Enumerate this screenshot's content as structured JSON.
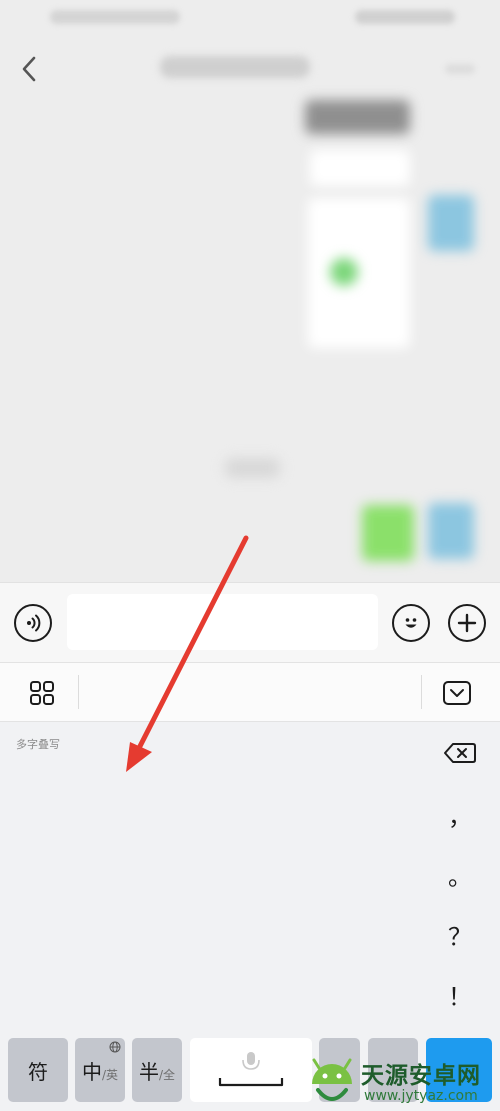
{
  "chat": {
    "title": "",
    "status_left": "",
    "status_right": ""
  },
  "input_bar": {
    "placeholder": ""
  },
  "keyboard": {
    "handwriting_hint": "多字叠写",
    "punctuation": {
      "comma": "，",
      "period": "。",
      "question": "？",
      "exclamation": "！"
    },
    "bottom_row": {
      "symbols": "符",
      "chinese_main": "中",
      "chinese_sub": "/英",
      "half_main": "半",
      "half_sub": "/全"
    }
  },
  "watermark": {
    "text": "天源安卓网",
    "url": "www.jytyaz.com"
  },
  "colors": {
    "send_key": "#1e9bef",
    "annotation_arrow": "#e53b30",
    "watermark_green": "#2e8b3e"
  }
}
